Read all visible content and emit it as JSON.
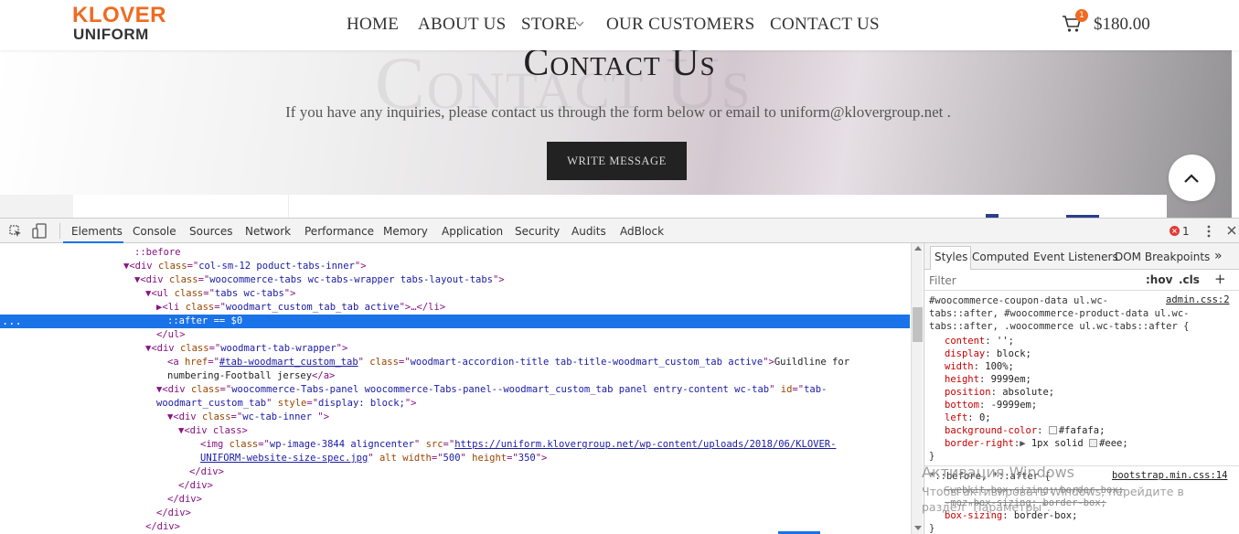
{
  "site": {
    "logo_top": "KLOVER",
    "logo_bottom": "UNIFORM",
    "nav": [
      "HOME",
      "ABOUT US",
      "STORE",
      "OUR CUSTOMERS",
      "CONTACT US"
    ],
    "cart_count": "1",
    "cart_total": "$180.00",
    "bg_title": "Contact Us",
    "page_title": "Contact Us",
    "subtitle": "If you have any inquiries, please contact us through the form below or email to uniform@klovergroup.net .",
    "write_button": "WRITE MESSAGE",
    "accent_color": "#ef6b21"
  },
  "devtools": {
    "tabs": [
      "Elements",
      "Console",
      "Sources",
      "Network",
      "Performance",
      "Memory",
      "Application",
      "Security",
      "Audits",
      "AdBlock"
    ],
    "error_count": "1",
    "dom": {
      "l0": "::before",
      "l1_tag": "div",
      "l1_attr": "class",
      "l1_val": "col-sm-12 poduct-tabs-inner",
      "l2_tag": "div",
      "l2_attr": "class",
      "l2_val": "woocommerce-tabs wc-tabs-wrapper tabs-layout-tabs",
      "l3_tag": "ul",
      "l3_attr": "class",
      "l3_val": "tabs wc-tabs",
      "l4_tag": "li",
      "l4_attr": "class",
      "l4_val": "woodmart_custom_tab_tab active",
      "l5": "::after == $0",
      "l6": "</ul>",
      "l7_tag": "div",
      "l7_attr": "class",
      "l7_val": "woodmart-tab-wrapper",
      "l8_href": "#tab-woodmart_custom_tab",
      "l8_class": "woodmart-accordion-title tab-title-woodmart_custom_tab active",
      "l8_text": "Guildline for",
      "l9_text": "numbering-Football jersey",
      "l9_close": "</a>",
      "l10_class": "woocommerce-Tabs-panel woocommerce-Tabs-panel--woodmart_custom_tab panel entry-content wc-tab",
      "l10_id_a": "tab-",
      "l11_id_b": "woodmart_custom_tab",
      "l11_style": "display: block;",
      "l12_class": "wc-tab-inner ",
      "l13": "<div class>",
      "l14_class": "wp-image-3844 aligncenter",
      "l14_src_a": "https://uniform.klovergroup.net/wp-content/uploads/2018/06/KLOVER-",
      "l15_src_b": "UNIFORM-website-size-spec.jpg",
      "l15_width": "500",
      "l15_height": "350",
      "l16": "</div>",
      "l17": "</div>",
      "l18": "</div>",
      "l19": "</div>",
      "l20": "</div>",
      "dots": "..."
    },
    "side_tabs": [
      "Styles",
      "Computed",
      "Event Listeners",
      "DOM Breakpoints"
    ],
    "filter_placeholder": "Filter",
    "hov": ":hov",
    "cls": ".cls",
    "rule1": {
      "selector_1": "#woocommerce-coupon-data ul.wc-",
      "selector_2": "tabs::after, #woocommerce-product-data ul.wc-",
      "selector_3": "tabs::after, .woocommerce ul.wc-tabs::after {",
      "source": "admin.css:2",
      "props": [
        {
          "p": "content",
          "v": "'';"
        },
        {
          "p": "display",
          "v": "block;"
        },
        {
          "p": "width",
          "v": "100%;"
        },
        {
          "p": "height",
          "v": "9999em;"
        },
        {
          "p": "position",
          "v": "absolute;"
        },
        {
          "p": "bottom",
          "v": "-9999em;"
        },
        {
          "p": "left",
          "v": "0;"
        },
        {
          "p": "background-color",
          "v": "#fafafa;"
        },
        {
          "p": "border-right",
          "v": "1px solid #eee;"
        }
      ],
      "close": "}"
    },
    "rule2": {
      "selector": "*::before, *::after {",
      "source": "bootstrap.min.css:14",
      "p1": "-webkit-box-sizing: border-box;",
      "p2": "-moz-box-sizing: border-box;",
      "p3_p": "box-sizing",
      "p3_v": "border-box;",
      "close": "}"
    },
    "swatch_colors": [
      "#fafafa",
      "#eeeeee"
    ]
  },
  "watermark": {
    "line1": "Активация Windows",
    "line2": "Чтобы активировать Windows, перейдите в",
    "line3": "раздел \"Параметры\"."
  }
}
